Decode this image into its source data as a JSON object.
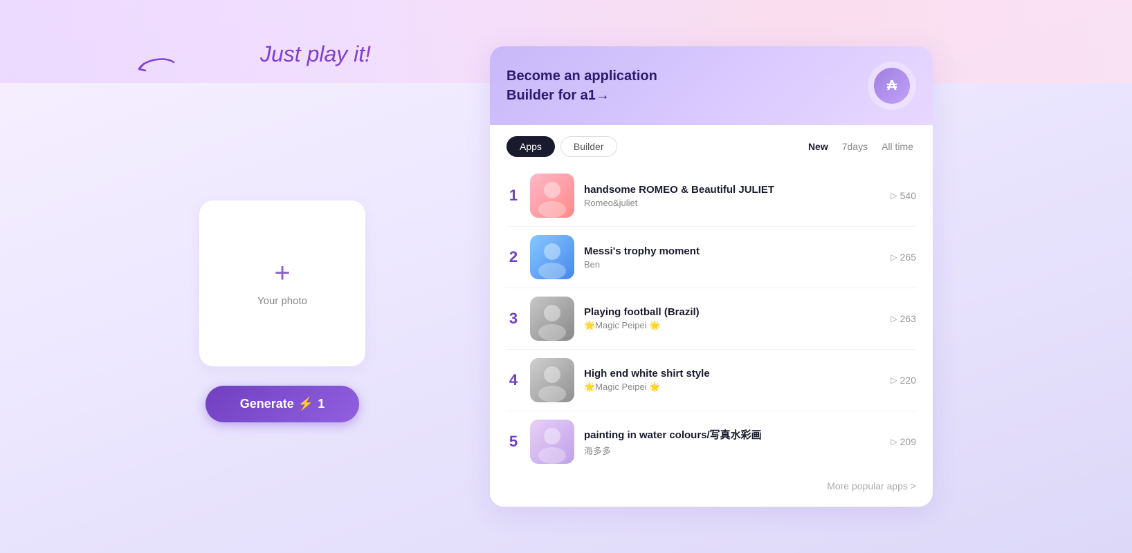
{
  "page": {
    "background": "#f5f0ff"
  },
  "left_panel": {
    "handwriting": "Just play it!",
    "photo_placeholder": "Your photo",
    "generate_button": "Generate",
    "generate_credits": "1"
  },
  "banner": {
    "line1": "Become an application",
    "line2": "Builder for a1→"
  },
  "tabs": [
    {
      "id": "apps",
      "label": "Apps",
      "active": true
    },
    {
      "id": "builder",
      "label": "Builder",
      "active": false
    }
  ],
  "filters": [
    {
      "id": "new",
      "label": "New",
      "active": true
    },
    {
      "id": "7days",
      "label": "7days",
      "active": false
    },
    {
      "id": "alltime",
      "label": "All time",
      "active": false
    }
  ],
  "apps": [
    {
      "rank": "1",
      "title": "handsome ROMEO & Beautiful JULIET",
      "author": "Romeo&juliet",
      "plays": "540",
      "thumb_class": "thumb-1"
    },
    {
      "rank": "2",
      "title": "Messi's trophy moment",
      "author": "Ben",
      "plays": "265",
      "thumb_class": "thumb-2"
    },
    {
      "rank": "3",
      "title": "Playing football (Brazil)",
      "author": "🌟Magic Peipei 🌟",
      "plays": "263",
      "thumb_class": "thumb-3"
    },
    {
      "rank": "4",
      "title": "High end white shirt style",
      "author": "🌟Magic Peipei 🌟",
      "plays": "220",
      "thumb_class": "thumb-4"
    },
    {
      "rank": "5",
      "title": "painting in water colours/写真水彩画",
      "author": "海多多",
      "plays": "209",
      "thumb_class": "thumb-5"
    }
  ],
  "more_link": "More popular apps >"
}
